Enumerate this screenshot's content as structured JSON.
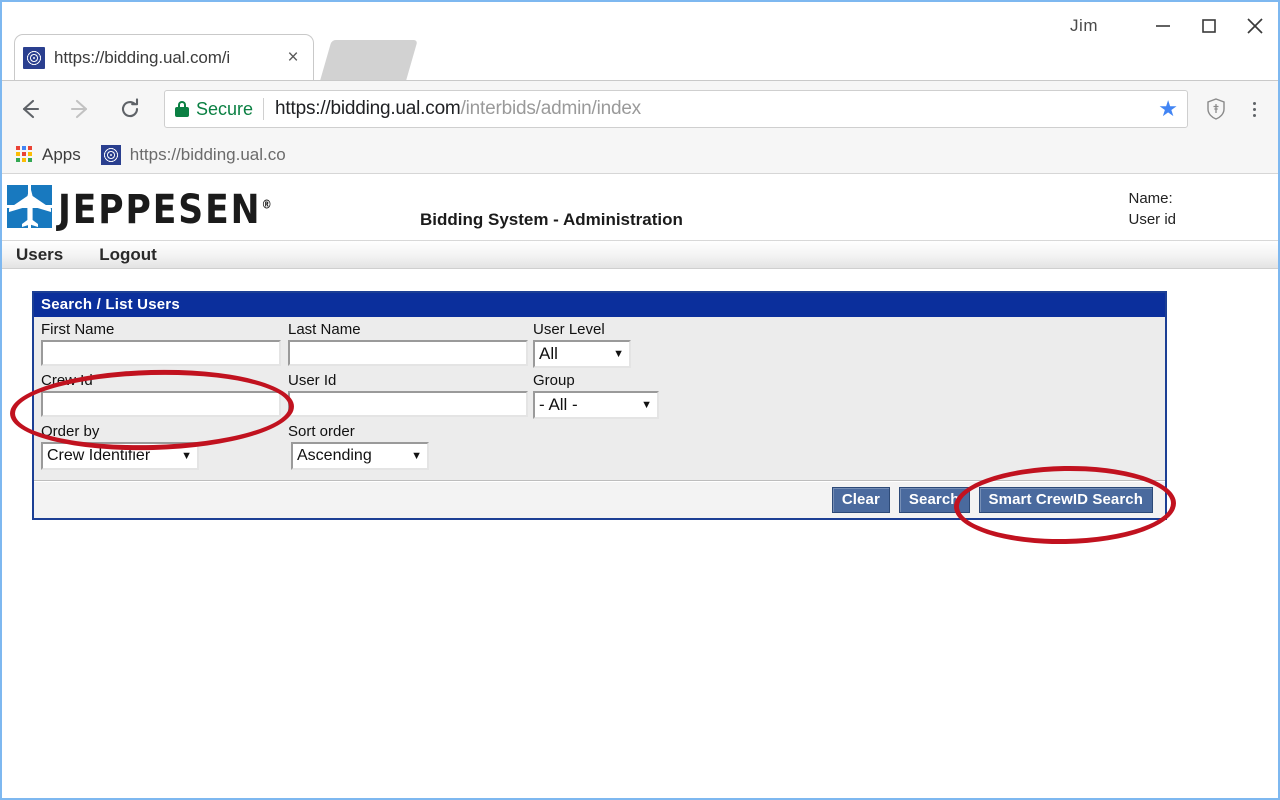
{
  "browser": {
    "profile_name": "Jim",
    "window_buttons": {
      "minimize": "minimize-icon",
      "maximize": "maximize-icon",
      "close": "close-icon"
    },
    "tab": {
      "title": "https://bidding.ual.com/i",
      "favicon": "globe-favicon",
      "close_label": "×"
    },
    "omnibox": {
      "secure_label": "Secure",
      "url_domain": "https://bidding.ual.com",
      "url_path": "/interbids/admin/index",
      "full_url": "https://bidding.ual.com/interbids/admin/index",
      "lock_icon": "lock-icon",
      "star_icon": "star-icon",
      "extension_icon": "shield-extension-icon",
      "menu_icon": "three-dot-menu-icon"
    },
    "nav": {
      "back": "back-arrow-icon",
      "forward": "forward-arrow-icon",
      "reload": "reload-icon"
    },
    "bookmarks": {
      "apps_label": "Apps",
      "apps_icon": "apps-grid-icon",
      "items": [
        {
          "label": "https://bidding.ual.co",
          "favicon": "globe-favicon"
        }
      ]
    }
  },
  "app": {
    "brand": "JEPPESEN",
    "brand_registered": "®",
    "subtitle": "Bidding System - Administration",
    "logo_icon": "jeppesen-plane-logo",
    "user_info": {
      "name_label": "Name:",
      "userid_label": "User id"
    },
    "nav_items": [
      {
        "label": "Users"
      },
      {
        "label": "Logout"
      }
    ]
  },
  "panel": {
    "title": "Search / List Users",
    "fields": {
      "first_name": {
        "label": "First Name",
        "value": "",
        "placeholder": ""
      },
      "last_name": {
        "label": "Last Name",
        "value": "",
        "placeholder": ""
      },
      "user_level": {
        "label": "User Level",
        "value": "All"
      },
      "crew_id": {
        "label": "Crew Id",
        "value": "",
        "placeholder": ""
      },
      "user_id": {
        "label": "User Id",
        "value": "",
        "placeholder": ""
      },
      "group": {
        "label": "Group",
        "value": "- All -"
      },
      "order_by": {
        "label": "Order by",
        "value": "Crew Identifier"
      },
      "sort_order": {
        "label": "Sort order",
        "value": "Ascending"
      }
    },
    "buttons": {
      "clear": "Clear",
      "search": "Search",
      "smart_crewid_search": "Smart CrewID Search"
    },
    "caret_glyph": "▼"
  },
  "annotations": [
    {
      "name": "crew-id-highlight",
      "shape": "ellipse",
      "color": "#c1121f"
    },
    {
      "name": "smart-crewid-search-highlight",
      "shape": "ellipse",
      "color": "#c1121f"
    }
  ],
  "colors": {
    "panel_border": "#1c3f94",
    "panel_title_bg": "#0b2f9c",
    "button_bg": "#4a6a9e",
    "logo_blue": "#1879bf",
    "secure_green": "#0b8043",
    "annotation_red": "#c1121f",
    "window_border": "#7eb8f0"
  }
}
